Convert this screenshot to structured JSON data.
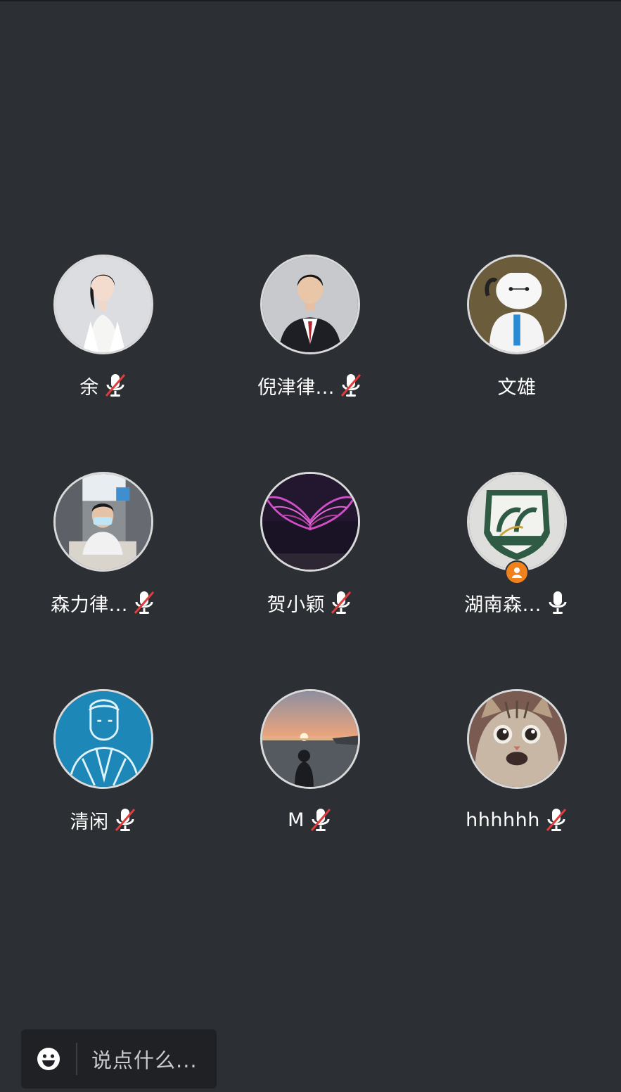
{
  "participants": [
    {
      "name": "余",
      "mic": "muted"
    },
    {
      "name": "倪津律...",
      "mic": "muted"
    },
    {
      "name": "文雄",
      "mic": "none"
    },
    {
      "name": "森力律...",
      "mic": "muted"
    },
    {
      "name": "贺小颖",
      "mic": "muted"
    },
    {
      "name": "湖南森...",
      "mic": "on",
      "badge": "host-icon"
    },
    {
      "name": "清闲",
      "mic": "muted"
    },
    {
      "name": "M",
      "mic": "muted"
    },
    {
      "name": "hhhhhh",
      "mic": "muted"
    }
  ],
  "chat": {
    "placeholder": "说点什么..."
  },
  "colors": {
    "background": "#2c2f33",
    "badge": "#f0821e",
    "mute_slash": "#e03c3c"
  }
}
